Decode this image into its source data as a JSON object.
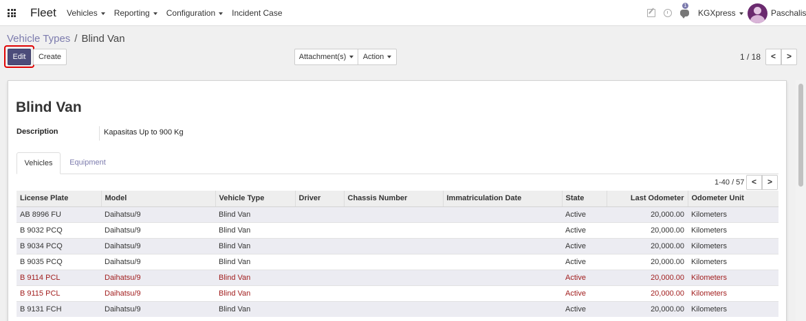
{
  "navbar": {
    "app_name": "Fleet",
    "menu": [
      "Vehicles",
      "Reporting",
      "Configuration",
      "Incident Case"
    ],
    "menu_has_caret": [
      true,
      true,
      true,
      false
    ],
    "chat_badge": "1",
    "company": "KGXpress",
    "user": "Paschalis",
    "icons": [
      "apps-grid-icon",
      "edit-icon",
      "clock-icon",
      "chat-icon",
      "avatar"
    ]
  },
  "breadcrumb": {
    "parent": "Vehicle Types",
    "separator": "/",
    "current": "Blind Van"
  },
  "buttons": {
    "edit": "Edit",
    "create": "Create",
    "attachments": "Attachment(s)",
    "action": "Action"
  },
  "pager": {
    "value": "1 / 18",
    "prev": "<",
    "next": ">"
  },
  "form": {
    "title": "Blind Van",
    "description_label": "Description",
    "description_value": "Kapasitas Up to 900 Kg"
  },
  "tabs": [
    "Vehicles",
    "Equipment"
  ],
  "list": {
    "pager": "1-40 / 57",
    "prev": "<",
    "next": ">",
    "columns": [
      "License Plate",
      "Model",
      "Vehicle Type",
      "Driver",
      "Chassis Number",
      "Immatriculation Date",
      "State",
      "Last Odometer",
      "Odometer Unit"
    ],
    "rows": [
      {
        "plate": "AB 8996 FU",
        "model": "Daihatsu/9",
        "type": "Blind Van",
        "driver": "",
        "chassis": "",
        "date": "",
        "state": "Active",
        "odometer": "20,000.00",
        "unit": "Kilometers",
        "warn": false
      },
      {
        "plate": "B 9032 PCQ",
        "model": "Daihatsu/9",
        "type": "Blind Van",
        "driver": "",
        "chassis": "",
        "date": "",
        "state": "Active",
        "odometer": "20,000.00",
        "unit": "Kilometers",
        "warn": false
      },
      {
        "plate": "B 9034 PCQ",
        "model": "Daihatsu/9",
        "type": "Blind Van",
        "driver": "",
        "chassis": "",
        "date": "",
        "state": "Active",
        "odometer": "20,000.00",
        "unit": "Kilometers",
        "warn": false
      },
      {
        "plate": "B 9035 PCQ",
        "model": "Daihatsu/9",
        "type": "Blind Van",
        "driver": "",
        "chassis": "",
        "date": "",
        "state": "Active",
        "odometer": "20,000.00",
        "unit": "Kilometers",
        "warn": false
      },
      {
        "plate": "B 9114 PCL",
        "model": "Daihatsu/9",
        "type": "Blind Van",
        "driver": "",
        "chassis": "",
        "date": "",
        "state": "Active",
        "odometer": "20,000.00",
        "unit": "Kilometers",
        "warn": true
      },
      {
        "plate": "B 9115 PCL",
        "model": "Daihatsu/9",
        "type": "Blind Van",
        "driver": "",
        "chassis": "",
        "date": "",
        "state": "Active",
        "odometer": "20,000.00",
        "unit": "Kilometers",
        "warn": true
      },
      {
        "plate": "B 9131 FCH",
        "model": "Daihatsu/9",
        "type": "Blind Van",
        "driver": "",
        "chassis": "",
        "date": "",
        "state": "Active",
        "odometer": "20,000.00",
        "unit": "Kilometers",
        "warn": false
      }
    ]
  },
  "colors": {
    "accent": "#7c7bad",
    "primary_button": "#4c4c7a",
    "highlight_box": "#e00000",
    "warning_text": "#a11d1d"
  }
}
